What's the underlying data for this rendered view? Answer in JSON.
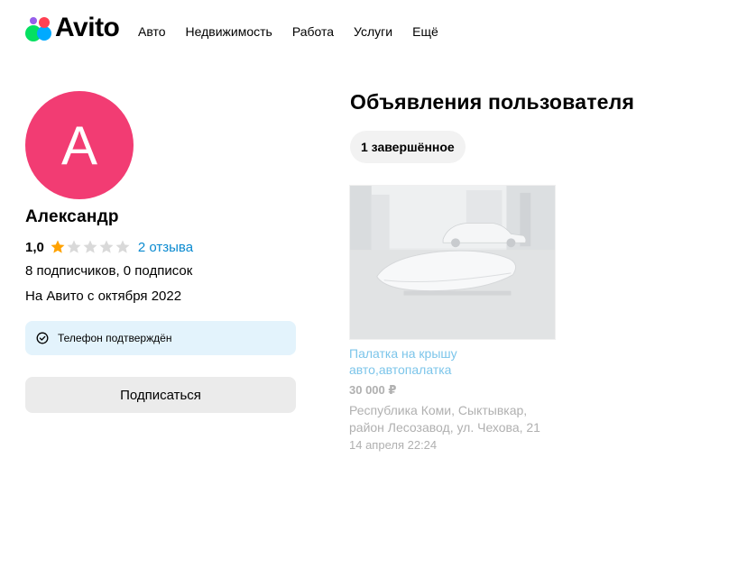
{
  "header": {
    "logo_text": "Avito",
    "nav": [
      "Авто",
      "Недвижимость",
      "Работа",
      "Услуги",
      "Ещё"
    ]
  },
  "profile": {
    "avatar_letter": "A",
    "avatar_color": "#f23c73",
    "name": "Александр",
    "rating": "1,0",
    "rating_stars": 1,
    "rating_max": 5,
    "reviews_link": "2 отзыва",
    "subscriptions": "8 подписчиков, 0 подписок",
    "member_since": "На Авито с октября 2022",
    "verified_text": "Телефон подтверждён",
    "subscribe_button": "Подписаться"
  },
  "listings": {
    "title": "Объявления пользователя",
    "tab": "1 завершённое",
    "items": [
      {
        "title": "Палатка на крышу авто,автопалатка",
        "price": "30 000 ₽",
        "address": "Республика Коми, Сыктывкар, район Лесозавод, ул. Чехова, 21",
        "date": "14 апреля 22:24"
      }
    ]
  },
  "colors": {
    "accent_link": "#0a8ad0",
    "star_active": "#ffa200",
    "star_inactive": "#d9d9d9",
    "verified_bg": "#e3f3fc"
  }
}
